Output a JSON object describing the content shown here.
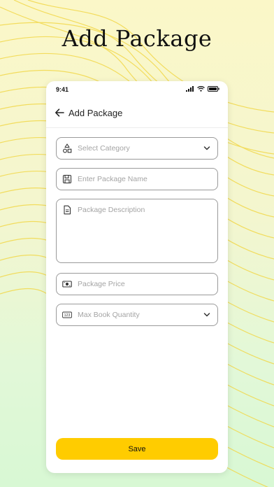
{
  "hero": {
    "title": "Add Package"
  },
  "status_bar": {
    "time": "9:41"
  },
  "header": {
    "title": "Add Package"
  },
  "form": {
    "category": {
      "placeholder": "Select Category",
      "icon": "shapes-icon"
    },
    "package_name": {
      "placeholder": "Enter Package Name",
      "icon": "save-icon"
    },
    "package_description": {
      "placeholder": "Package Description",
      "icon": "document-icon"
    },
    "package_price": {
      "placeholder": "Package Price",
      "icon": "money-icon"
    },
    "max_book_quantity": {
      "placeholder": "Max Book Quantity",
      "icon": "numbers-icon"
    }
  },
  "save_button": {
    "label": "Save"
  },
  "colors": {
    "accent": "#ffcc00",
    "wave": "#f2d84a",
    "border": "#9a9a9a"
  }
}
